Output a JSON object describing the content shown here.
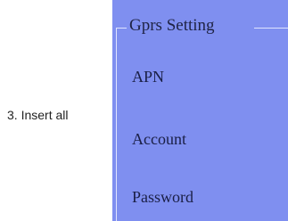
{
  "caption": "3. Insert all",
  "panel": {
    "legend": "Gprs Setting",
    "fields": [
      {
        "label": "APN"
      },
      {
        "label": "Account"
      },
      {
        "label": "Password"
      }
    ],
    "colors": {
      "background": "#7f8ff0",
      "border": "#dfe4ff",
      "text": "#1a1f45"
    }
  }
}
